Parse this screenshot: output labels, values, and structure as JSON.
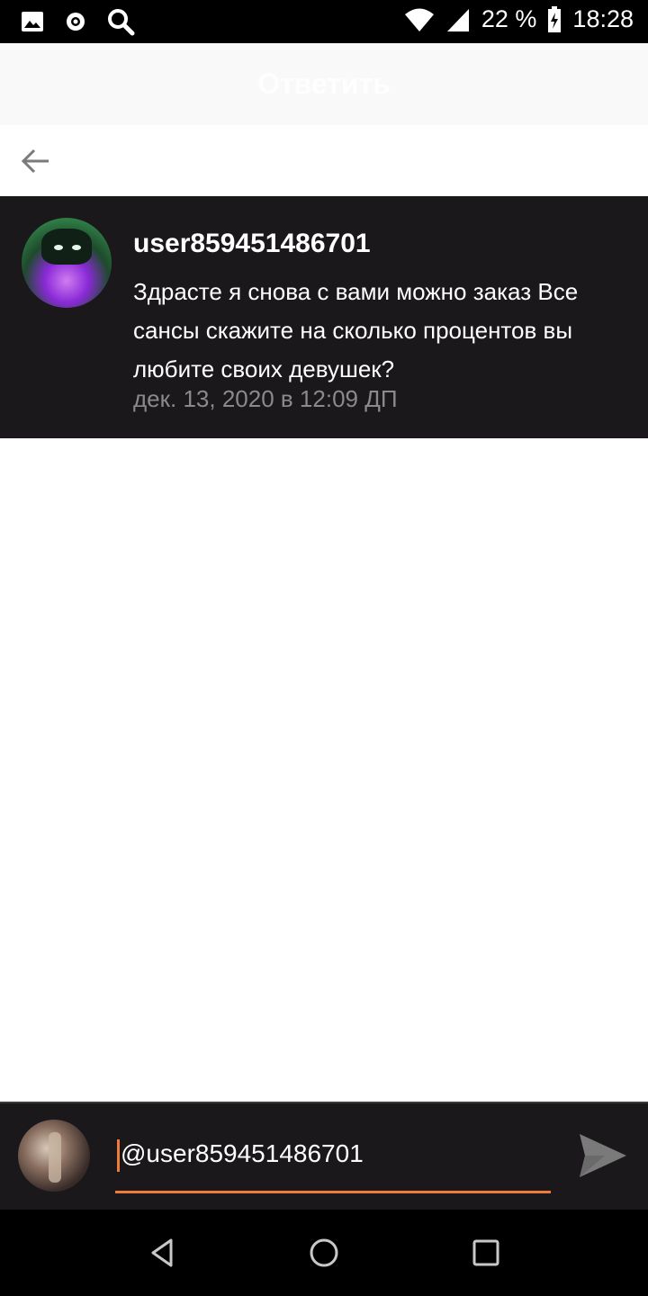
{
  "status_bar": {
    "battery": "22 %",
    "time": "18:28",
    "icons": [
      "image-icon",
      "circle-dot-icon",
      "search-icon",
      "wifi-icon",
      "signal-icon",
      "battery-charging-icon"
    ]
  },
  "header": {
    "title": "Ответить"
  },
  "toolbar": {
    "back_icon": "arrow-left-icon"
  },
  "comment": {
    "author": "user859451486701",
    "text": "Здрасте я снова с вами можно заказ Все сансы скажите на сколько процентов вы любите своих девушек?",
    "timestamp": "дек. 13, 2020 в 12:09 ДП"
  },
  "reply": {
    "input_value": "@user859451486701",
    "accent_color": "#f07a3a",
    "send_icon": "send-icon"
  },
  "nav": {
    "icons": [
      "back-triangle-icon",
      "home-circle-icon",
      "recents-square-icon"
    ]
  }
}
